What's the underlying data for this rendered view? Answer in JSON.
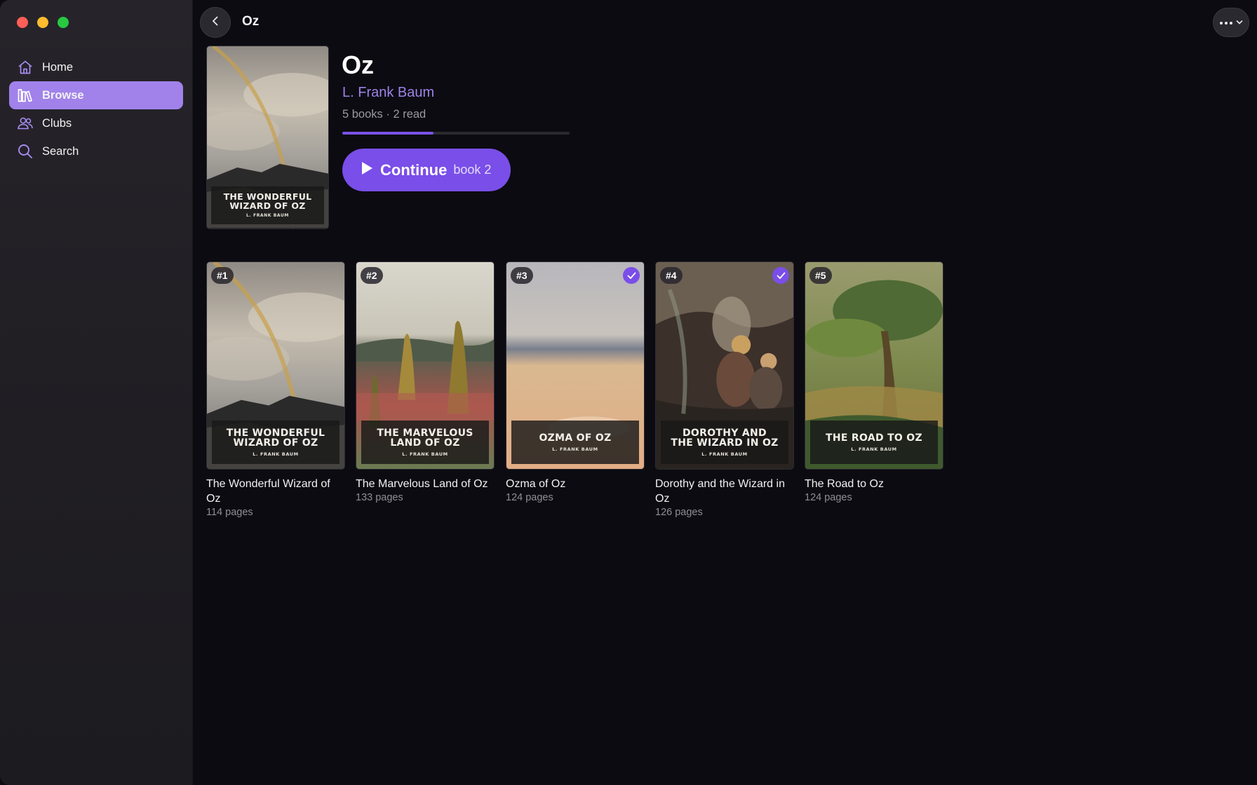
{
  "window": {
    "traffic_lights": [
      "close",
      "minimize",
      "zoom"
    ]
  },
  "sidebar": {
    "items": [
      {
        "label": "Home",
        "icon": "home-icon",
        "active": false
      },
      {
        "label": "Browse",
        "icon": "library-icon",
        "active": true
      },
      {
        "label": "Clubs",
        "icon": "people-icon",
        "active": false
      },
      {
        "label": "Search",
        "icon": "search-icon",
        "active": false
      }
    ]
  },
  "topbar": {
    "title": "Oz",
    "back_icon": "chevron-left-icon",
    "more_icon": "ellipsis-icon"
  },
  "series": {
    "title": "Oz",
    "author": "L. Frank Baum",
    "meta": "5 books · 2 read",
    "progress": 0.4,
    "cover_title": "THE WONDERFUL\nWIZARD OF OZ",
    "cover_author": "L. FRANK BAUM",
    "continue": {
      "label": "Continue",
      "sub": "book 2",
      "icon": "play-icon"
    }
  },
  "books": [
    {
      "num": "#1",
      "title": "The Wonderful Wizard of Oz",
      "pages": "114 pages",
      "cover_title": "THE WONDERFUL\nWIZARD OF OZ",
      "cover_author": "L. FRANK BAUM",
      "read": false
    },
    {
      "num": "#2",
      "title": "The Marvelous Land of Oz",
      "pages": "133 pages",
      "cover_title": "THE MARVELOUS\nLAND OF OZ",
      "cover_author": "L. FRANK BAUM",
      "read": false
    },
    {
      "num": "#3",
      "title": "Ozma of Oz",
      "pages": "124 pages",
      "cover_title": "OZMA OF OZ",
      "cover_author": "L. FRANK BAUM",
      "read": true
    },
    {
      "num": "#4",
      "title": "Dorothy and the Wizard in Oz",
      "pages": "126 pages",
      "cover_title": "DOROTHY AND\nTHE WIZARD IN OZ",
      "cover_author": "L. FRANK BAUM",
      "read": true
    },
    {
      "num": "#5",
      "title": "The Road to Oz",
      "pages": "124 pages",
      "cover_title": "THE ROAD TO OZ",
      "cover_author": "L. FRANK BAUM",
      "read": false
    }
  ],
  "colors": {
    "accent": "#7a4ee8",
    "sidebar_active": "#a182ea",
    "author": "#9d82e8",
    "background": "#0c0b11"
  }
}
